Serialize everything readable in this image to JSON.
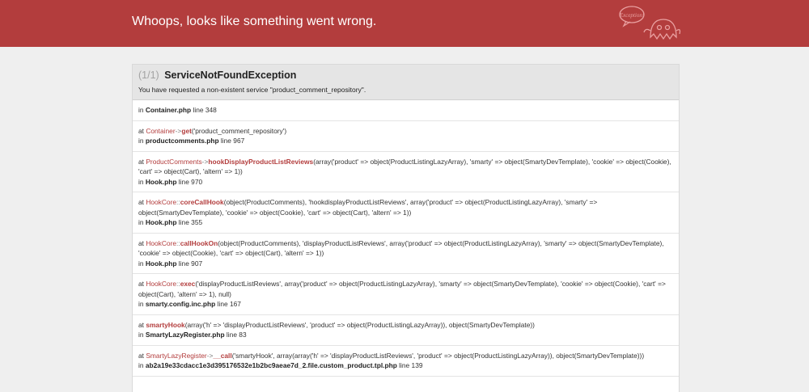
{
  "header": {
    "title": "Whoops, looks like something went wrong.",
    "logo_text": "Exception!"
  },
  "exception": {
    "count": "(1/1)",
    "name": "ServiceNotFoundException",
    "message": "You have requested a non-existent service \"product_comment_repository\"."
  },
  "trace": [
    {
      "location": "in ",
      "file": "Container.php",
      "line": " line 348"
    },
    {
      "at": "at ",
      "class": "Container",
      "arrow": "->",
      "function": "get",
      "args": "('product_comment_repository')",
      "location": "in ",
      "file": "productcomments.php",
      "line": " line 967"
    },
    {
      "at": "at ",
      "class": "ProductComments",
      "arrow": "->",
      "function": "hookDisplayProductListReviews",
      "args": "(array('product' => object(ProductListingLazyArray), 'smarty' => object(SmartyDevTemplate), 'cookie' => object(Cookie), 'cart' => object(Cart), 'altern' => 1))",
      "location": "in ",
      "file": "Hook.php",
      "line": " line 970"
    },
    {
      "at": "at ",
      "class": "HookCore",
      "arrow": "::",
      "function": "coreCallHook",
      "args": "(object(ProductComments), 'hookdisplayProductListReviews', array('product' => object(ProductListingLazyArray), 'smarty' => object(SmartyDevTemplate), 'cookie' => object(Cookie), 'cart' => object(Cart), 'altern' => 1))",
      "location": "in ",
      "file": "Hook.php",
      "line": " line 355"
    },
    {
      "at": "at ",
      "class": "HookCore",
      "arrow": "::",
      "function": "callHookOn",
      "args": "(object(ProductComments), 'displayProductListReviews', array('product' => object(ProductListingLazyArray), 'smarty' => object(SmartyDevTemplate), 'cookie' => object(Cookie), 'cart' => object(Cart), 'altern' => 1))",
      "location": "in ",
      "file": "Hook.php",
      "line": " line 907"
    },
    {
      "at": "at ",
      "class": "HookCore",
      "arrow": "::",
      "function": "exec",
      "args": "('displayProductListReviews', array('product' => object(ProductListingLazyArray), 'smarty' => object(SmartyDevTemplate), 'cookie' => object(Cookie), 'cart' => object(Cart), 'altern' => 1), null)",
      "location": "in ",
      "file": "smarty.config.inc.php",
      "line": " line 167"
    },
    {
      "at": "at ",
      "class": "",
      "arrow": "",
      "function": "smartyHook",
      "args": "(array('h' => 'displayProductListReviews', 'product' => object(ProductListingLazyArray)), object(SmartyDevTemplate))",
      "location": "in ",
      "file": "SmartyLazyRegister.php",
      "line": " line 83"
    },
    {
      "at": "at ",
      "class": "SmartyLazyRegister",
      "arrow": "->",
      "function": "__call",
      "args": "('smartyHook', array(array('h' => 'displayProductListReviews', 'product' => object(ProductListingLazyArray)), object(SmartyDevTemplate)))",
      "location": "in ",
      "file": "ab2a19e33cdacc1e3d395176532e1b2bc9aeae7d_2.file.custom_product.tpl.php",
      "line": " line 139"
    }
  ]
}
